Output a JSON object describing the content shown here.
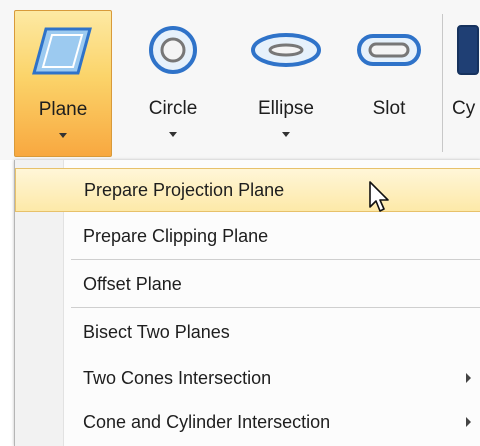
{
  "ribbon": {
    "buttons": [
      {
        "label": "Plane",
        "icon": "plane-icon",
        "active": true,
        "has_dropdown": true
      },
      {
        "label": "Circle",
        "icon": "circle-icon",
        "active": false,
        "has_dropdown": true
      },
      {
        "label": "Ellipse",
        "icon": "ellipse-icon",
        "active": false,
        "has_dropdown": true
      },
      {
        "label": "Slot",
        "icon": "slot-icon",
        "active": false,
        "has_dropdown": false
      },
      {
        "label": "Cy",
        "icon": "cylinder-icon",
        "active": false,
        "has_dropdown": false
      }
    ]
  },
  "menu": {
    "items": [
      {
        "label": "Prepare Projection Plane",
        "highlighted": true
      },
      {
        "label": "Prepare Clipping Plane"
      },
      {
        "label": "Offset Plane"
      },
      {
        "label": "Bisect Two Planes"
      },
      {
        "label": "Two Cones Intersection",
        "submenu": true
      },
      {
        "label": "Cone and Cylinder Intersection",
        "submenu": true
      }
    ]
  },
  "colors": {
    "accent_active": "#f8a840",
    "icon_blue": "#2f73c9",
    "menu_highlight": "#fde9a8"
  }
}
